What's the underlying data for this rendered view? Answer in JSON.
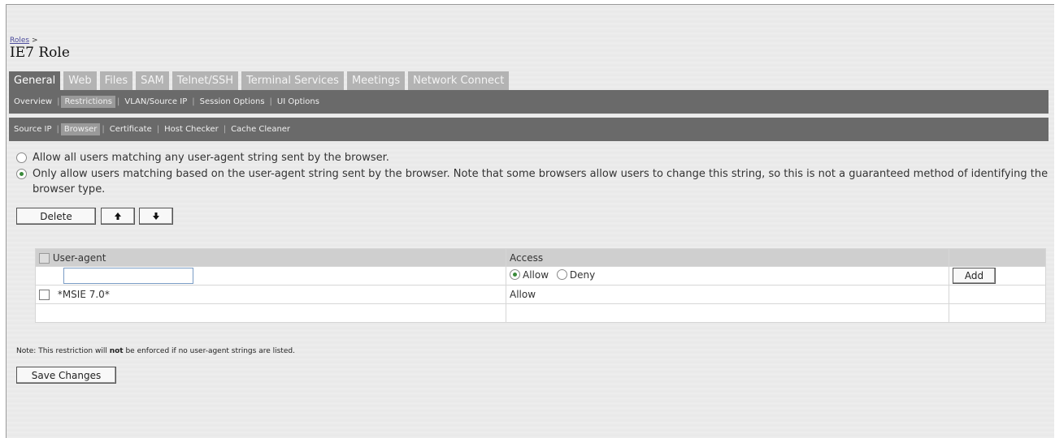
{
  "breadcrumb": {
    "link": "Roles",
    "separator": ">"
  },
  "page_title": "IE7 Role",
  "tabs": [
    {
      "label": "General",
      "active": true
    },
    {
      "label": "Web",
      "active": false
    },
    {
      "label": "Files",
      "active": false
    },
    {
      "label": "SAM",
      "active": false
    },
    {
      "label": "Telnet/SSH",
      "active": false
    },
    {
      "label": "Terminal Services",
      "active": false
    },
    {
      "label": "Meetings",
      "active": false
    },
    {
      "label": "Network Connect",
      "active": false
    }
  ],
  "subnav1": [
    {
      "label": "Overview",
      "active": false
    },
    {
      "label": "Restrictions",
      "active": true
    },
    {
      "label": "VLAN/Source IP",
      "active": false
    },
    {
      "label": "Session Options",
      "active": false
    },
    {
      "label": "UI Options",
      "active": false
    }
  ],
  "subnav2": [
    {
      "label": "Source IP",
      "active": false
    },
    {
      "label": "Browser",
      "active": true
    },
    {
      "label": "Certificate",
      "active": false
    },
    {
      "label": "Host Checker",
      "active": false
    },
    {
      "label": "Cache Cleaner",
      "active": false
    }
  ],
  "options": {
    "allow_all": {
      "text": "Allow all users matching any user-agent string sent by the browser.",
      "checked": false
    },
    "only_allow": {
      "text": "Only allow users matching based on the user-agent string sent by the browser. Note that some browsers allow users to change this string, so this is not a guaranteed method of identifying the browser type.",
      "checked": true
    }
  },
  "toolbar": {
    "delete_label": "Delete",
    "up_icon": "arrow-up-icon",
    "down_icon": "arrow-down-icon"
  },
  "table": {
    "headers": {
      "user_agent": "User-agent",
      "access": "Access"
    },
    "new_row": {
      "input_value": "",
      "allow_label": "Allow",
      "deny_label": "Deny",
      "selected": "Allow",
      "add_label": "Add"
    },
    "rows": [
      {
        "user_agent": "*MSIE 7.0*",
        "access": "Allow",
        "checked": false
      }
    ]
  },
  "note": {
    "prefix": "Note: This restriction will ",
    "bold": "not",
    "suffix": " be enforced if no user-agent strings are listed."
  },
  "save_label": "Save Changes",
  "colors": {
    "tab_active": "#6b6b6b",
    "tab_inactive": "#b3b3b3",
    "subnav_bar": "#6a6a6a",
    "input_border": "#7a9cc5"
  }
}
